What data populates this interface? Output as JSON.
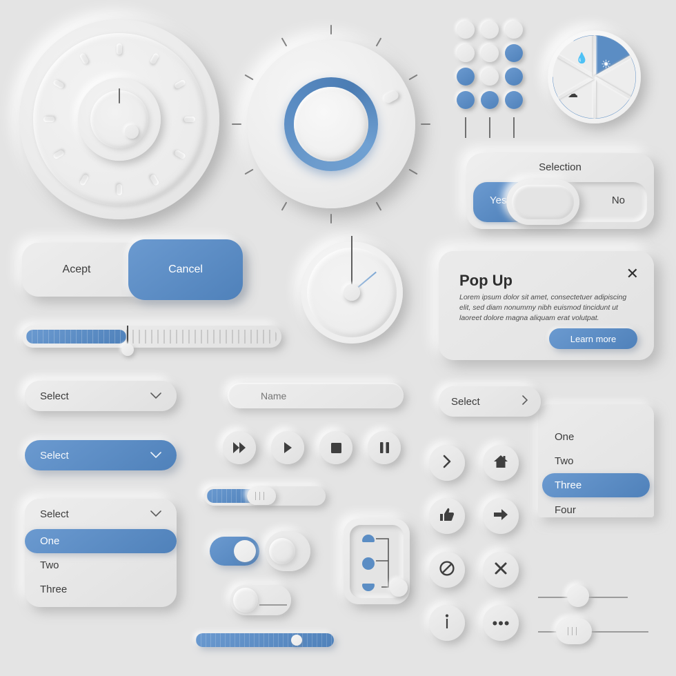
{
  "theme": {
    "background": "#e4e4e4",
    "surface": "#e9e9e9",
    "accent_blue": "#5b8dc4",
    "accent_blue_dark": "#4f81ba",
    "text_dark": "#3c3c3c",
    "text_light": "#ffffff"
  },
  "dial_one": {
    "name": "Rotary dial",
    "pip_count": 12,
    "needle_angle_deg": 0
  },
  "dial_two": {
    "name": "Blue ring knob",
    "tick_count": 12
  },
  "dot_matrix": {
    "rows": [
      [
        false,
        false,
        false
      ],
      [
        false,
        false,
        true
      ],
      [
        true,
        false,
        true
      ],
      [
        true,
        true,
        true
      ]
    ],
    "line_count": 3
  },
  "weather_wheel": {
    "segments": 6,
    "active_segment_index": 0,
    "icons": {
      "sun": "sun-icon",
      "rain": "raindrops-icon",
      "cloud": "cloud-icon"
    }
  },
  "selection": {
    "title": "Selection",
    "yes_label": "Yes",
    "no_label": "No",
    "value": "Yes"
  },
  "accept_bar": {
    "accept_label": "Acept",
    "cancel_label": "Cancel"
  },
  "tick_slider": {
    "fill_percent": 40,
    "tick_count": 26
  },
  "gauge": {
    "name": "Clock gauge",
    "dark_hand_angle_deg": 0,
    "blue_hand_angle_deg": 50
  },
  "popup": {
    "title": "Pop Up",
    "body": "Lorem ipsum dolor sit amet, consectetuer adipiscing elit, sed diam nonummy nibh euismod tincidunt ut laoreet dolore magna aliquam erat volutpat.",
    "button_label": "Learn more",
    "close_icon": "close-icon"
  },
  "select_plain": {
    "label": "Select",
    "chevron": "chevron-down-icon"
  },
  "select_blue": {
    "label": "Select",
    "chevron": "chevron-down-icon"
  },
  "select_open": {
    "label": "Select",
    "chevron": "chevron-down-icon",
    "options": [
      "One",
      "Two",
      "Three"
    ],
    "selected": "One"
  },
  "name_field": {
    "placeholder": "Name",
    "value": ""
  },
  "media_buttons": [
    {
      "name": "fast-forward-button",
      "icon": "fast-forward-icon"
    },
    {
      "name": "play-button",
      "icon": "play-icon"
    },
    {
      "name": "stop-button",
      "icon": "stop-icon"
    },
    {
      "name": "pause-button",
      "icon": "pause-icon"
    }
  ],
  "mini_slider": {
    "fill_percent": 40
  },
  "toggles": {
    "on_state": "on",
    "off_state": "off",
    "line_state": "off"
  },
  "vertical_panel": {
    "dot_count": 3,
    "knob_position": "bottom"
  },
  "blue_bar": {
    "fill_percent": 70
  },
  "icon_grid": [
    {
      "name": "chevron-right-button",
      "icon": "chevron-right-icon"
    },
    {
      "name": "home-button",
      "icon": "home-icon"
    },
    {
      "name": "thumbs-up-button",
      "icon": "thumbs-up-icon"
    },
    {
      "name": "arrow-right-button",
      "icon": "arrow-right-icon"
    },
    {
      "name": "block-button",
      "icon": "ban-icon"
    },
    {
      "name": "close-button",
      "icon": "close-icon"
    },
    {
      "name": "info-button",
      "icon": "info-icon"
    },
    {
      "name": "more-button",
      "icon": "more-horizontal-icon"
    }
  ],
  "right_select": {
    "label": "Select",
    "chevron": "chevron-right-icon",
    "options": [
      "One",
      "Two",
      "Three",
      "Four"
    ],
    "selected": "Three"
  },
  "thin_sliders": [
    {
      "name": "thin-slider-round",
      "value_percent": 55,
      "handle": "round"
    },
    {
      "name": "thin-slider-grip",
      "value_percent": 35,
      "handle": "grip"
    }
  ]
}
